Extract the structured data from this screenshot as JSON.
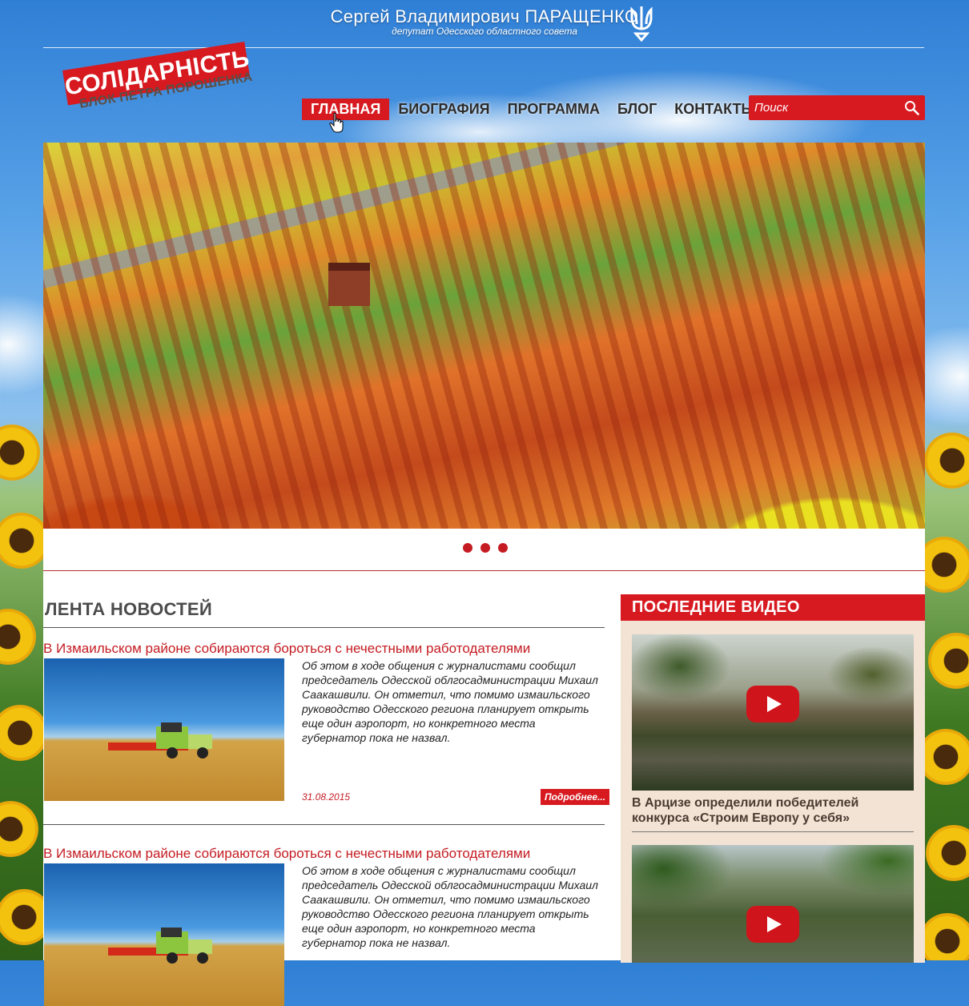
{
  "header": {
    "name": "Сергей Владимирович ПАРАЩЕНКО",
    "subtitle": "депутат  Одесского  областного совета"
  },
  "logo": {
    "title": "СОЛІДАРНІСТЬ",
    "subtitle": "БЛОК ПЕТРА ПОРОШЕНКА"
  },
  "nav": {
    "items": [
      {
        "label": "ГЛАВНАЯ",
        "active": true
      },
      {
        "label": "БИОГРАФИЯ",
        "active": false
      },
      {
        "label": "ПРОГРАММА",
        "active": false
      },
      {
        "label": "БЛОГ",
        "active": false
      },
      {
        "label": "КОНТАКТЫ",
        "active": false
      }
    ]
  },
  "search": {
    "placeholder": "Поиск"
  },
  "slider": {
    "dot_count": 3
  },
  "news": {
    "heading": "ЛЕНТА НОВОСТЕЙ",
    "articles": [
      {
        "title": "В Измаильском районе собираются бороться с нечестными работодателями",
        "text": "Об этом в ходе общения с журналистами сообщил председатель Одесской облгосадминистрации Михаил Саакашвили. Он отметил, что помимо измаильского руководство Одесского региона планирует открыть еще один аэропорт, но конкретного места губернатор пока не назвал.",
        "date": "31.08.2015",
        "more": "Подробнее..."
      },
      {
        "title": "В Измаильском районе собираются бороться с нечестными работодателями",
        "text": "Об этом в ходе общения с журналистами сообщил председатель Одесской облгосадминистрации Михаил Саакашвили. Он отметил, что помимо измаильского руководство Одесского региона планирует открыть еще один аэропорт, но конкретного места губернатор пока не назвал.",
        "date": "",
        "more": ""
      }
    ]
  },
  "sidebar": {
    "heading": "ПОСЛЕДНИЕ ВИДЕО",
    "videos": [
      {
        "caption": "В Арцизе определили победителей конкурса «Строим Европу у себя»"
      },
      {
        "caption": ""
      }
    ]
  },
  "colors": {
    "brand_red": "#d71920",
    "text_dark": "#2c2c2c",
    "sidebar_bg": "#f2e3d5"
  },
  "icons": [
    "trident-icon",
    "search-icon",
    "play-icon",
    "cursor-icon"
  ]
}
